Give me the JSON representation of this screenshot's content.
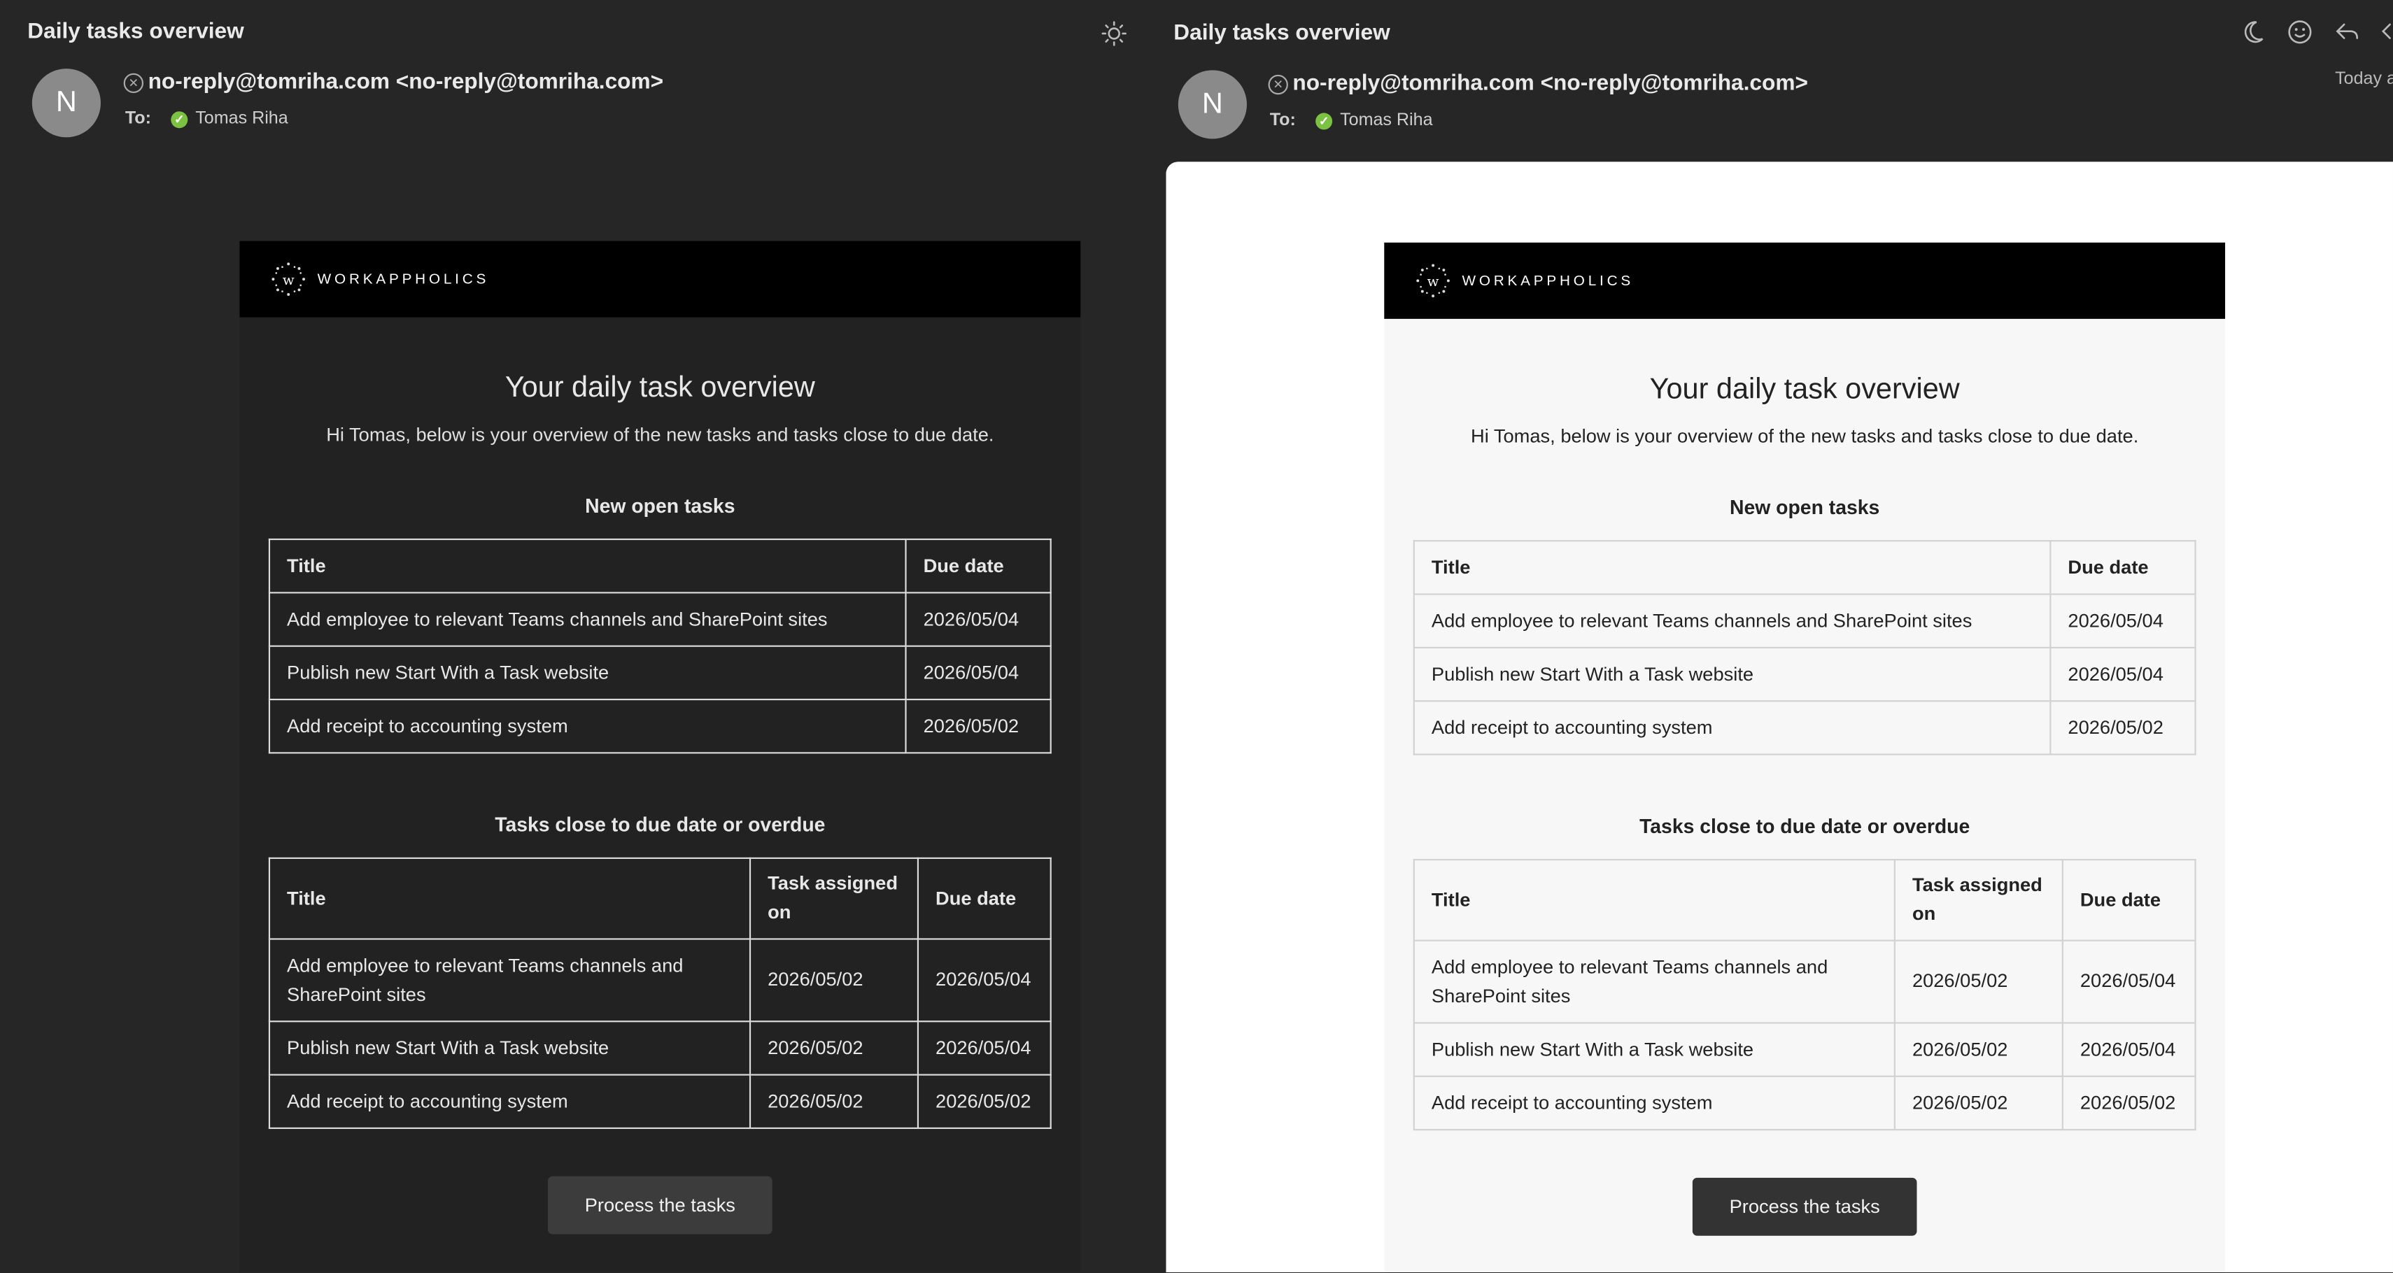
{
  "subject": "Daily tasks overview",
  "avatar_letter": "N",
  "sender": "no-reply@tomriha.com <no-reply@tomriha.com>",
  "to_label": "To:",
  "recipient": "Tomas Riha",
  "today_label": "Today a",
  "icons": {
    "left_header": "sun-icon",
    "right_header": [
      "moon-icon",
      "emoji-icon",
      "reply-icon",
      "reply-all-icon"
    ],
    "sender_badge": "remove-icon",
    "recipient_badge": "check-icon"
  },
  "brand": "WORKAPPHOLICS",
  "email": {
    "title": "Your daily task overview",
    "intro": "Hi Tomas, below is your overview of the new tasks and tasks close to due date.",
    "new_tasks_title": "New open tasks",
    "new_tasks_headers": [
      "Title",
      "Due date"
    ],
    "new_tasks": [
      {
        "title": "Add employee to relevant Teams channels and SharePoint sites",
        "due": "2026/05/04"
      },
      {
        "title": "Publish new Start With a Task website",
        "due": "2026/05/04"
      },
      {
        "title": "Add receipt to accounting system",
        "due": "2026/05/02"
      }
    ],
    "due_tasks_title": "Tasks close to due date or overdue",
    "due_tasks_headers": [
      "Title",
      "Task assigned on",
      "Due date"
    ],
    "due_tasks": [
      {
        "title": "Add employee to relevant Teams channels and SharePoint sites",
        "assigned": "2026/05/02",
        "due": "2026/05/04"
      },
      {
        "title": "Publish new Start With a Task website",
        "assigned": "2026/05/02",
        "due": "2026/05/04"
      },
      {
        "title": "Add receipt to accounting system",
        "assigned": "2026/05/02",
        "due": "2026/05/02"
      }
    ],
    "button_label": "Process the tasks"
  },
  "colors": {
    "dark_background": "#262626",
    "dark_email_body": "#222222",
    "light_email_body": "#f7f7f7",
    "header_bar": "#000000",
    "button": "#3c3c3c",
    "verified_green": "#7cc242"
  }
}
